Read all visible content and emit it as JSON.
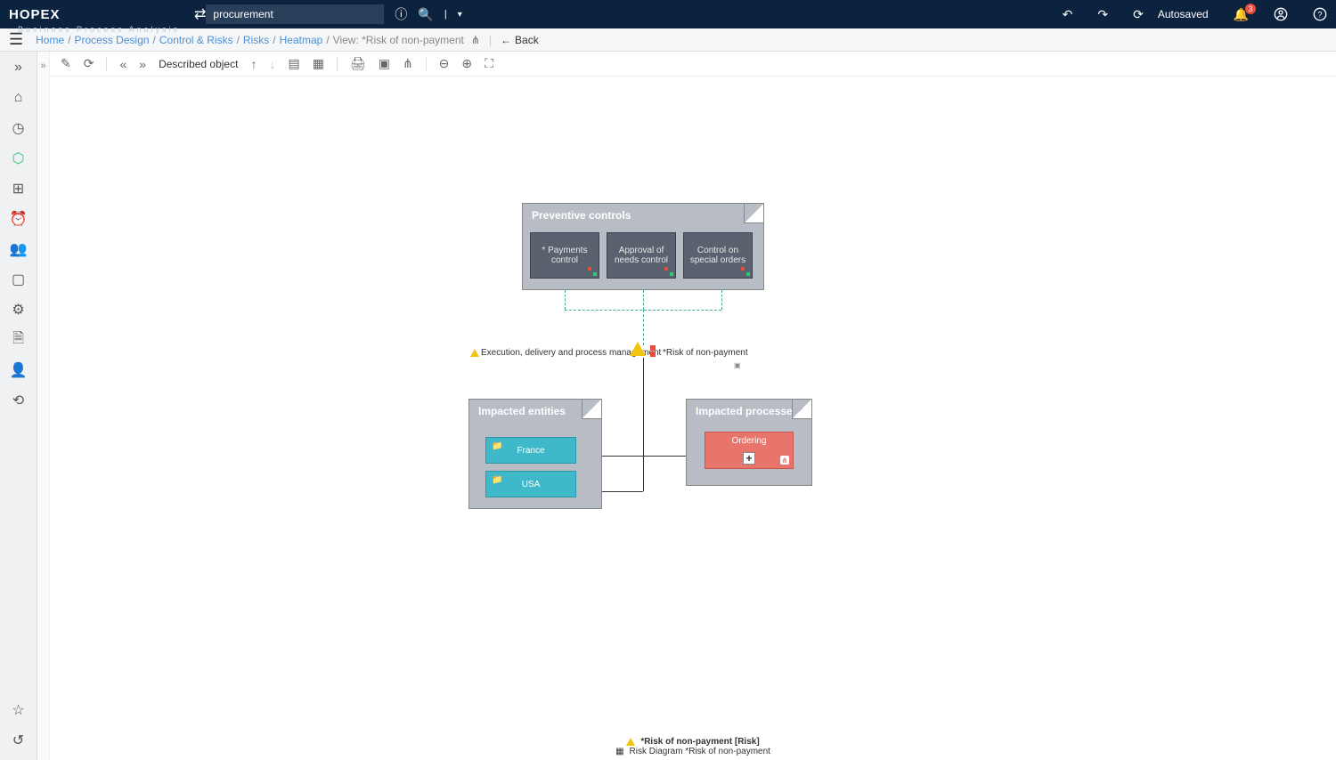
{
  "header": {
    "logo": "HOPEX",
    "subtitle": "Business Process Analysis",
    "search_value": "procurement",
    "autosaved": "Autosaved",
    "notification_count": "3"
  },
  "breadcrumb": {
    "items": [
      "Home",
      "Process Design",
      "Control & Risks",
      "Risks",
      "Heatmap"
    ],
    "current": "View: *Risk of non-payment",
    "back": "Back"
  },
  "toolbar": {
    "described": "Described object"
  },
  "diagram": {
    "preventive_title": "Preventive controls",
    "controls": [
      "* Payments control",
      "Approval of needs control",
      "Control on special orders"
    ],
    "risk_left": "Execution, delivery and process management",
    "risk_right": "*Risk of non-payment",
    "entities_title": "Impacted entities",
    "entities": [
      "France",
      "USA"
    ],
    "processes_title": "Impacted processes",
    "process": "Ordering"
  },
  "footer": {
    "line1": "*Risk of non-payment [Risk]",
    "line2": "Risk Diagram *Risk of non-payment"
  }
}
